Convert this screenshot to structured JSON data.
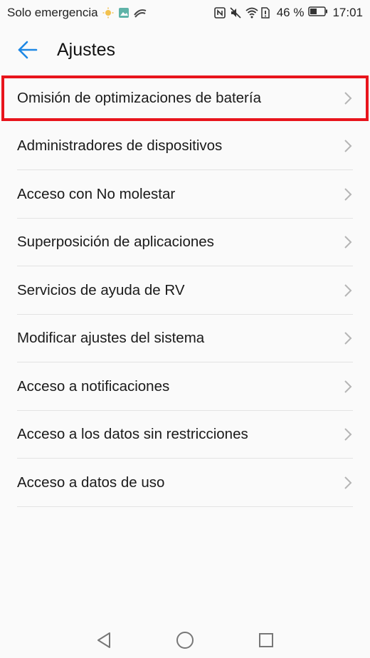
{
  "status_bar": {
    "carrier": "Solo emergencia",
    "battery_percent": "46 %",
    "time": "17:01",
    "icons": [
      "sun-icon",
      "image-icon",
      "swift-icon",
      "nfc-icon",
      "mute-icon",
      "wifi-icon",
      "sim-alert-icon",
      "battery-icon"
    ]
  },
  "app_bar": {
    "title": "Ajustes",
    "back_icon": "arrow-left-icon"
  },
  "settings": {
    "items": [
      {
        "label": "Omisión de optimizaciones de batería"
      },
      {
        "label": "Administradores de dispositivos"
      },
      {
        "label": "Acceso con No molestar"
      },
      {
        "label": "Superposición de aplicaciones"
      },
      {
        "label": "Servicios de ayuda de RV"
      },
      {
        "label": "Modificar ajustes del sistema"
      },
      {
        "label": "Acceso a notificaciones"
      },
      {
        "label": "Acceso a los datos sin restricciones"
      },
      {
        "label": "Acceso a datos de uso"
      }
    ]
  },
  "nav_bar": {
    "icons": [
      "back-triangle-icon",
      "home-circle-icon",
      "recents-square-icon"
    ]
  },
  "colors": {
    "accent": "#1e88e5",
    "highlight": "#e8141c",
    "divider": "#e3e3e3",
    "background": "#fafafa"
  }
}
